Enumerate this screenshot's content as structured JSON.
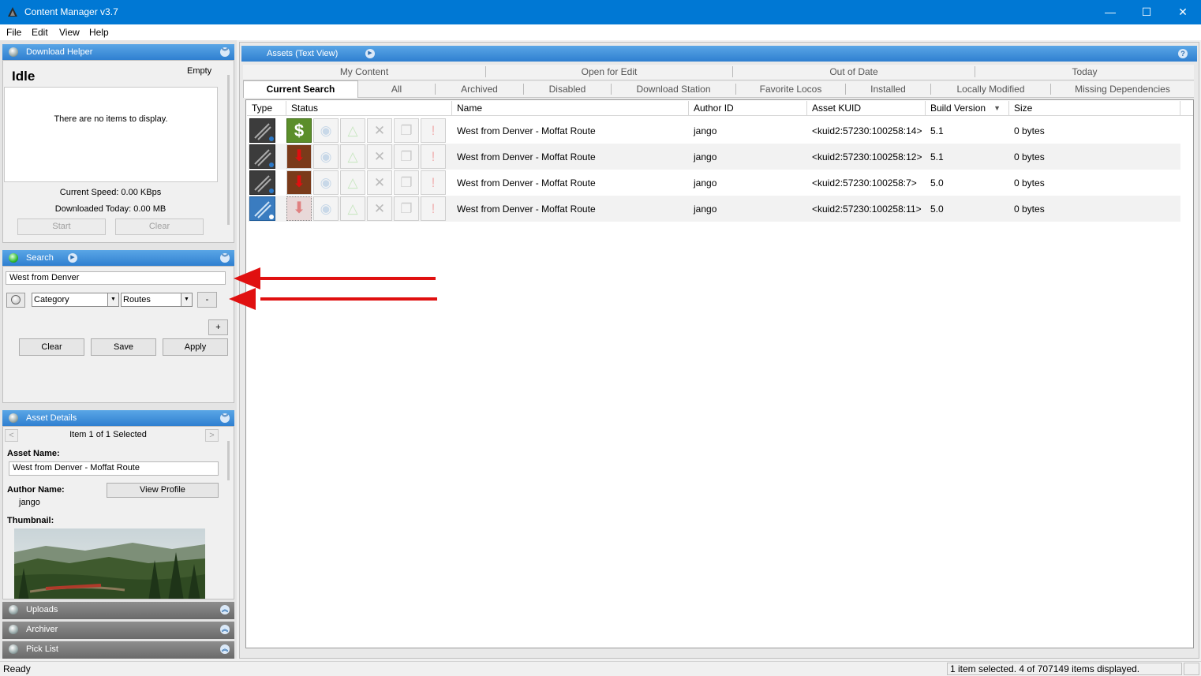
{
  "window": {
    "title": "Content Manager v3.7",
    "minimize": "—",
    "maximize": "☐",
    "close": "✕"
  },
  "menu": [
    "File",
    "Edit",
    "View",
    "Help"
  ],
  "download_helper": {
    "title": "Download Helper",
    "state": "Idle",
    "queue_status": "Empty",
    "empty_message": "There are no items to display.",
    "current_speed": "Current Speed: 0.00 KBps",
    "downloaded_today": "Downloaded Today: 0.00 MB",
    "start": "Start",
    "clear": "Clear"
  },
  "search": {
    "title": "Search",
    "query": "West from Denver",
    "filter_field": "Category",
    "filter_value": "Routes",
    "remove": "-",
    "add": "+",
    "clear": "Clear",
    "save": "Save",
    "apply": "Apply"
  },
  "asset_details": {
    "title": "Asset Details",
    "prev": "<",
    "next": ">",
    "selection": "Item 1 of 1 Selected",
    "asset_name_label": "Asset Name:",
    "asset_name": "West from Denver - Moffat Route",
    "author_name_label": "Author Name:",
    "view_profile": "View Profile",
    "author": "jango",
    "thumbnail_label": "Thumbnail:"
  },
  "collapsed_panels": [
    "Uploads",
    "Archiver",
    "Pick List"
  ],
  "assets": {
    "title": "Assets (Text View)",
    "help": "?",
    "tabs_row1": [
      "My Content",
      "Open for Edit",
      "Out of Date",
      "Today"
    ],
    "tabs_row2": [
      "Current Search",
      "All",
      "Archived",
      "Disabled",
      "Download Station",
      "Favorite Locos",
      "Installed",
      "Locally Modified",
      "Missing Dependencies"
    ],
    "columns": [
      "Type",
      "Status",
      "Name",
      "Author ID",
      "Asset KUID",
      "Build Version",
      "Size"
    ],
    "sort_indicator": "▼",
    "rows": [
      {
        "name": "West from Denver - Moffat Route",
        "author": "jango",
        "kuid": "<kuid2:57230:100258:14>",
        "build": "5.1",
        "size": "0 bytes",
        "status": "dollar"
      },
      {
        "name": "West from Denver - Moffat Route",
        "author": "jango",
        "kuid": "<kuid2:57230:100258:12>",
        "build": "5.1",
        "size": "0 bytes",
        "status": "download"
      },
      {
        "name": "West from Denver - Moffat Route",
        "author": "jango",
        "kuid": "<kuid2:57230:100258:7>",
        "build": "5.0",
        "size": "0 bytes",
        "status": "download"
      },
      {
        "name": "West from Denver - Moffat Route",
        "author": "jango",
        "kuid": "<kuid2:57230:100258:11>",
        "build": "5.0",
        "size": "0 bytes",
        "status": "download-faded"
      }
    ]
  },
  "statusbar": {
    "left": "Ready",
    "right": "1 item selected. 4 of 707149 items displayed."
  },
  "colors": {
    "accent": "#0078d4",
    "panel_header": "#2f7fd0",
    "annotation_arrow": "#e01010"
  }
}
